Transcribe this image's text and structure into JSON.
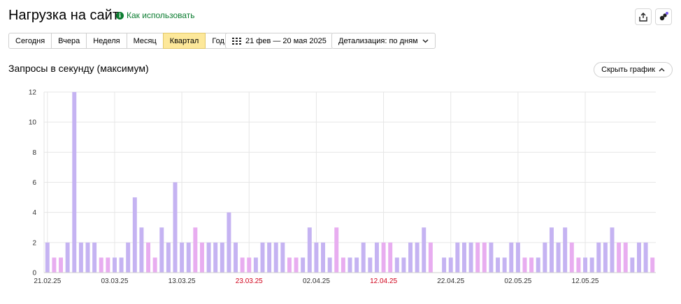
{
  "page": {
    "title": "Нагрузка на сайт",
    "help_label": "Как использовать"
  },
  "toolbar": {
    "periods": [
      "Сегодня",
      "Вчера",
      "Неделя",
      "Месяц",
      "Квартал",
      "Год"
    ],
    "active_period": "Квартал",
    "date_range": "21 фев — 20 мая 2025",
    "detail_label": "Детализация: по дням"
  },
  "section": {
    "title": "Запросы в секунду (максимум)",
    "hide_label": "Скрыть график"
  },
  "colors": {
    "weekday_bar": "#c5b3f2",
    "weekend_bar": "#e8adf0",
    "holiday_label": "#d0021b",
    "active_period": "#fde89a"
  },
  "icons": {
    "export": "share-icon",
    "assistant": "assistant-icon",
    "calendar": "calendar-icon"
  },
  "chart_data": {
    "type": "bar",
    "ylim": [
      0,
      12
    ],
    "yticks": [
      0,
      2,
      4,
      6,
      8,
      10,
      12
    ],
    "xtick_labels": [
      "21.02.25",
      "03.03.25",
      "13.03.25",
      "23.03.25",
      "02.04.25",
      "12.04.25",
      "22.04.25",
      "02.05.25",
      "12.05.25"
    ],
    "holiday_labels": [
      "23.03.25",
      "12.04.25"
    ],
    "values": [
      2,
      1,
      1,
      2,
      12,
      2,
      2,
      2,
      1,
      1,
      1,
      1,
      2,
      5,
      3,
      2,
      1,
      3,
      2,
      6,
      2,
      2,
      3,
      2,
      2,
      2,
      2,
      4,
      2,
      1,
      1,
      1,
      2,
      2,
      2,
      2,
      1,
      1,
      1,
      3,
      2,
      2,
      1,
      3,
      1,
      1,
      1,
      2,
      1,
      2,
      2,
      2,
      1,
      1,
      2,
      2,
      3,
      2,
      0,
      1,
      1,
      2,
      2,
      2,
      2,
      2,
      2,
      1,
      1,
      2,
      2,
      1,
      1,
      1,
      2,
      3,
      2,
      3,
      2,
      1,
      1,
      1,
      2,
      2,
      3,
      2,
      2,
      1,
      2,
      2,
      1
    ],
    "weekend": [
      false,
      true,
      true,
      false,
      false,
      false,
      false,
      false,
      true,
      true,
      false,
      false,
      false,
      false,
      false,
      true,
      true,
      false,
      false,
      false,
      false,
      false,
      true,
      true,
      false,
      false,
      false,
      false,
      false,
      true,
      true,
      false,
      false,
      false,
      false,
      false,
      true,
      true,
      false,
      false,
      false,
      false,
      false,
      true,
      true,
      false,
      false,
      false,
      false,
      false,
      true,
      true,
      false,
      false,
      false,
      false,
      false,
      true,
      true,
      false,
      false,
      false,
      false,
      false,
      true,
      true,
      false,
      false,
      false,
      false,
      false,
      true,
      true,
      false,
      false,
      false,
      false,
      false,
      true,
      true,
      false,
      false,
      false,
      false,
      false,
      true,
      true,
      false,
      false,
      false,
      true
    ]
  }
}
